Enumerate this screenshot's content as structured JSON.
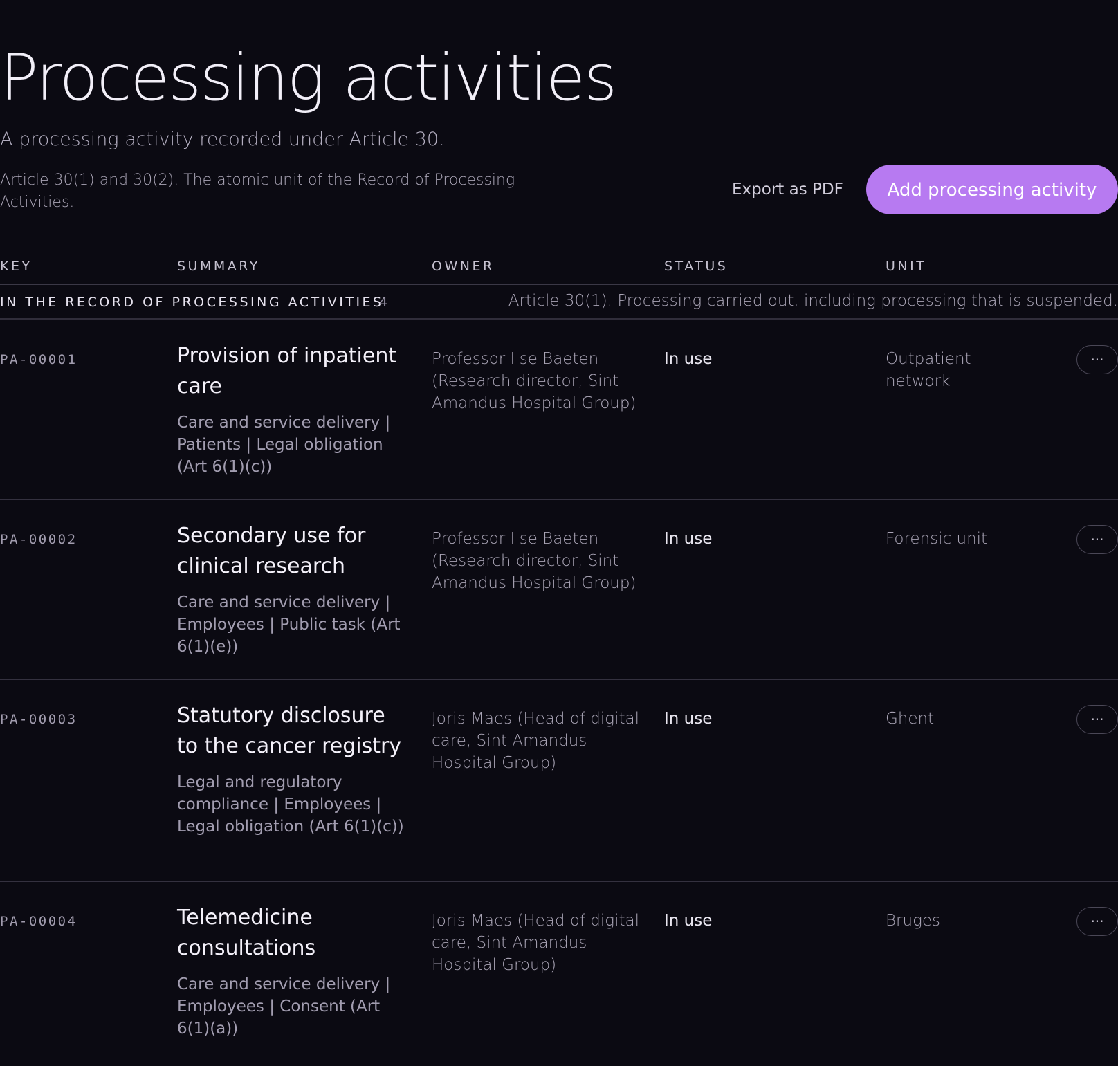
{
  "header": {
    "title": "Processing activities",
    "subtitle": "A processing activity recorded under Article 30.",
    "description": "Article 30(1) and 30(2). The atomic unit of the Record of Processing Activities.",
    "export_label": "Export as PDF",
    "add_label": "Add processing activity",
    "accent_color": "#b77af1"
  },
  "table": {
    "columns": [
      "KEY",
      "SUMMARY",
      "OWNER",
      "STATUS",
      "UNIT"
    ],
    "group": {
      "label": "IN THE RECORD OF PROCESSING ACTIVITIES",
      "count": "4",
      "note": "Article 30(1). Processing carried out, including processing that is suspended."
    },
    "row_menu_icon": "more-horizontal-icon",
    "row_menu_glyph": "···",
    "rows": [
      {
        "key": "PA-00001",
        "title": "Provision of inpatient care",
        "meta": "Care and service delivery | Patients | Legal obligation (Art 6(1)(c))",
        "owner": "Professor Ilse Baeten (Research director, Sint Amandus Hospital Group)",
        "status": "In use",
        "unit": "Outpatient network"
      },
      {
        "key": "PA-00002",
        "title": "Secondary use for clinical research",
        "meta": "Care and service delivery | Employees | Public task (Art 6(1)(e))",
        "owner": "Professor Ilse Baeten (Research director, Sint Amandus Hospital Group)",
        "status": "In use",
        "unit": "Forensic unit"
      },
      {
        "key": "PA-00003",
        "title": "Statutory disclosure to the cancer registry",
        "meta": "Legal and regulatory compliance | Employees | Legal obligation (Art 6(1)(c))",
        "owner": "Joris Maes (Head of digital care, Sint Amandus Hospital Group)",
        "status": "In use",
        "unit": "Ghent"
      },
      {
        "key": "PA-00004",
        "title": "Telemedicine consultations",
        "meta": "Care and service delivery | Employees | Consent (Art 6(1)(a))",
        "owner": "Joris Maes (Head of digital care, Sint Amandus Hospital Group)",
        "status": "In use",
        "unit": "Bruges"
      }
    ]
  }
}
